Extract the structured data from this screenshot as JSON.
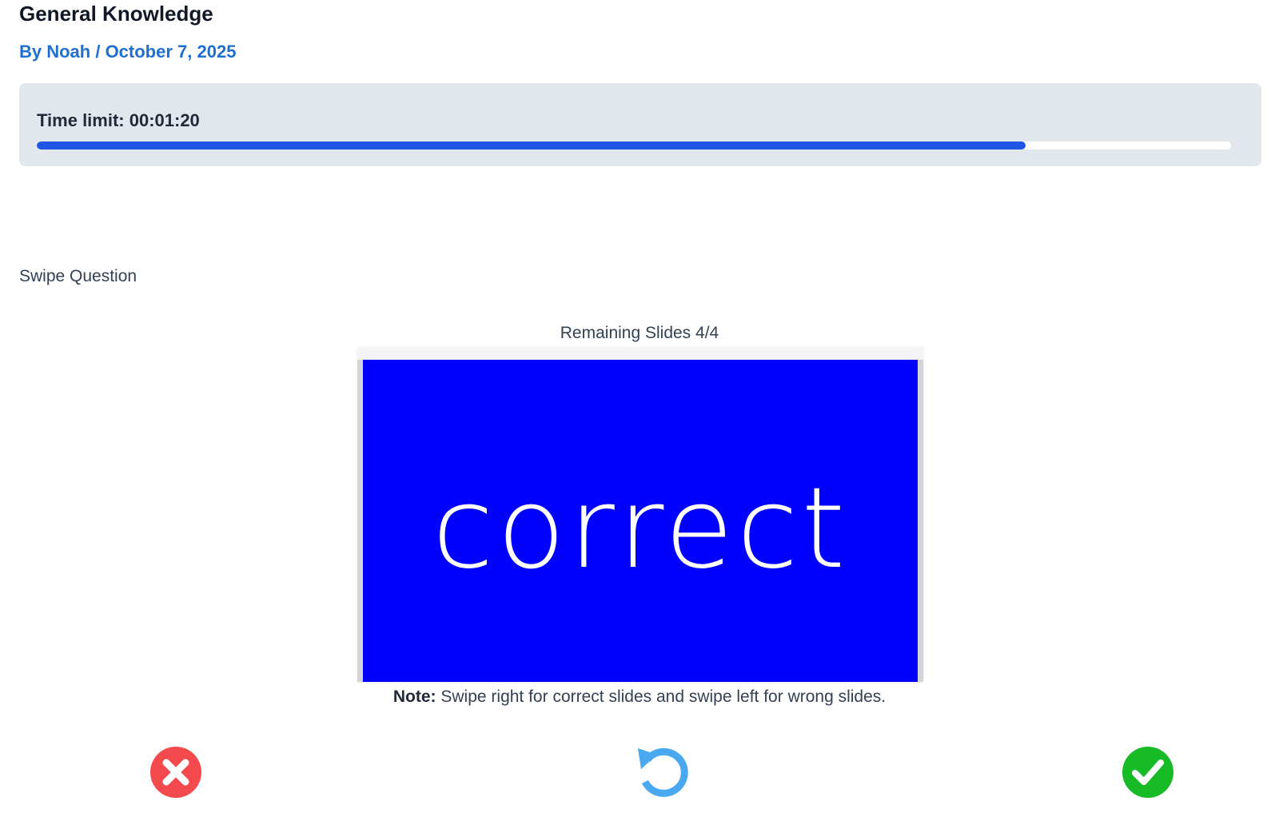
{
  "header": {
    "title": "General Knowledge",
    "byline": "By Noah / October 7, 2025"
  },
  "timer": {
    "label": "Time limit: 00:01:20",
    "progress_fraction": 0.828,
    "bar_color": "#2155e6"
  },
  "question": {
    "type_label": "Swipe Question",
    "remaining": "Remaining Slides 4/4",
    "card": {
      "word": "correct",
      "background": "#0000fe"
    },
    "note_bold": "Note:",
    "note_text": " Swipe right for correct slides and swipe left for wrong slides."
  },
  "actions": {
    "wrong": {
      "icon": "x-circle-icon",
      "color": "#f44a4e"
    },
    "reset": {
      "icon": "undo-icon",
      "color": "#4aa8f0"
    },
    "right": {
      "icon": "check-circle-icon",
      "color": "#17bb25"
    }
  }
}
